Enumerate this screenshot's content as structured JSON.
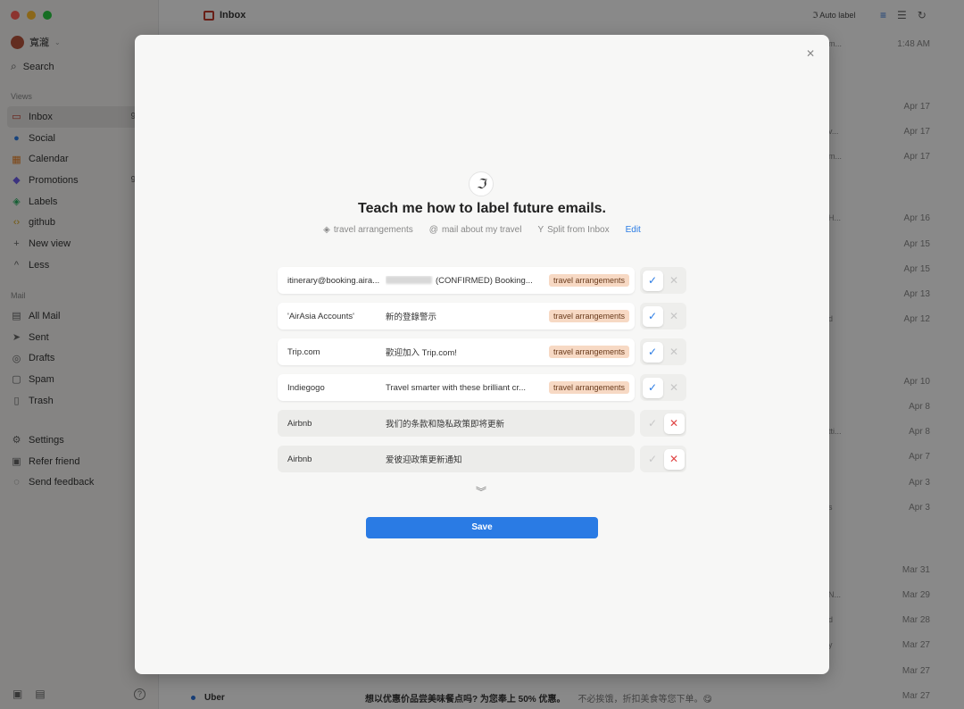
{
  "sidebar": {
    "account_name": "寬瀧",
    "search_label": "Search",
    "views_label": "Views",
    "views": [
      {
        "label": "Inbox",
        "icon": "inbox-icon",
        "count": "9"
      },
      {
        "label": "Social",
        "icon": "chat-bubble-icon",
        "count": ""
      },
      {
        "label": "Calendar",
        "icon": "calendar-icon",
        "count": ""
      },
      {
        "label": "Promotions",
        "icon": "shopping-bag-icon",
        "count": "9"
      },
      {
        "label": "Labels",
        "icon": "tag-icon",
        "count": ""
      },
      {
        "label": "github",
        "icon": "code-icon",
        "count": ""
      },
      {
        "label": "New view",
        "icon": "plus-icon",
        "count": ""
      },
      {
        "label": "Less",
        "icon": "chevron-up-icon",
        "count": ""
      }
    ],
    "mail_label": "Mail",
    "mail": [
      {
        "label": "All Mail",
        "icon": "tray-icon"
      },
      {
        "label": "Sent",
        "icon": "send-icon"
      },
      {
        "label": "Drafts",
        "icon": "draft-icon"
      },
      {
        "label": "Spam",
        "icon": "spam-icon"
      },
      {
        "label": "Trash",
        "icon": "trash-icon"
      }
    ],
    "footer": [
      {
        "label": "Settings",
        "icon": "gear-icon"
      },
      {
        "label": "Refer friend",
        "icon": "gift-icon"
      },
      {
        "label": "Send feedback",
        "icon": "feedback-icon"
      }
    ]
  },
  "topbar": {
    "title": "Inbox",
    "auto_label": "Auto label"
  },
  "list_dates": [
    "1:48 AM",
    "Apr 17",
    "Apr 17",
    "Apr 17",
    "Apr 16",
    "Apr 15",
    "Apr 15",
    "Apr 13",
    "Apr 12",
    "Apr 10",
    "Apr 8",
    "Apr 8",
    "Apr 7",
    "Apr 3",
    "Apr 3",
    "Mar 31",
    "Mar 29",
    "Mar 28",
    "Mar 27",
    "Mar 27",
    "Mar 27"
  ],
  "list_peeks": [
    "m...",
    "v...",
    "m...",
    "H...",
    "d",
    "tti...",
    "s",
    "N...",
    "d",
    "y"
  ],
  "last_row": {
    "sender": "Uber",
    "subject": "想以优惠价品尝美味餐点吗? 为您奉上 50% 优惠。",
    "snippet": "不必挨饿，折扣美食等您下单。😋"
  },
  "modal": {
    "headline": "Teach me how to label future emails.",
    "criteria": [
      {
        "icon": "tag-icon",
        "label": "travel arrangements"
      },
      {
        "icon": "at-icon",
        "label": "mail about my travel"
      },
      {
        "icon": "split-icon",
        "label": "Split from Inbox"
      }
    ],
    "edit_label": "Edit",
    "rows": [
      {
        "from": "itinerary@booking.aira...",
        "subject": "(CONFIRMED) Booking...",
        "tag": "travel arrangements",
        "state": "positive",
        "has_blur": true
      },
      {
        "from": "'AirAsia Accounts'",
        "subject": "新的登錄警示",
        "tag": "travel arrangements",
        "state": "positive",
        "has_blur": false
      },
      {
        "from": "Trip.com",
        "subject": "歡迎加入 Trip.com!",
        "tag": "travel arrangements",
        "state": "positive",
        "has_blur": false
      },
      {
        "from": "Indiegogo",
        "subject": "Travel smarter with these brilliant cr...",
        "tag": "travel arrangements",
        "state": "positive",
        "has_blur": false
      },
      {
        "from": "Airbnb",
        "subject": "我们的条款和隐私政策即将更新",
        "tag": "",
        "state": "negative",
        "has_blur": false
      },
      {
        "from": "Airbnb",
        "subject": "爱彼迎政策更新通知",
        "tag": "",
        "state": "negative",
        "has_blur": false
      }
    ],
    "save_label": "Save",
    "accent": "#2a7be4",
    "tag_color": "#f7d9c4"
  }
}
